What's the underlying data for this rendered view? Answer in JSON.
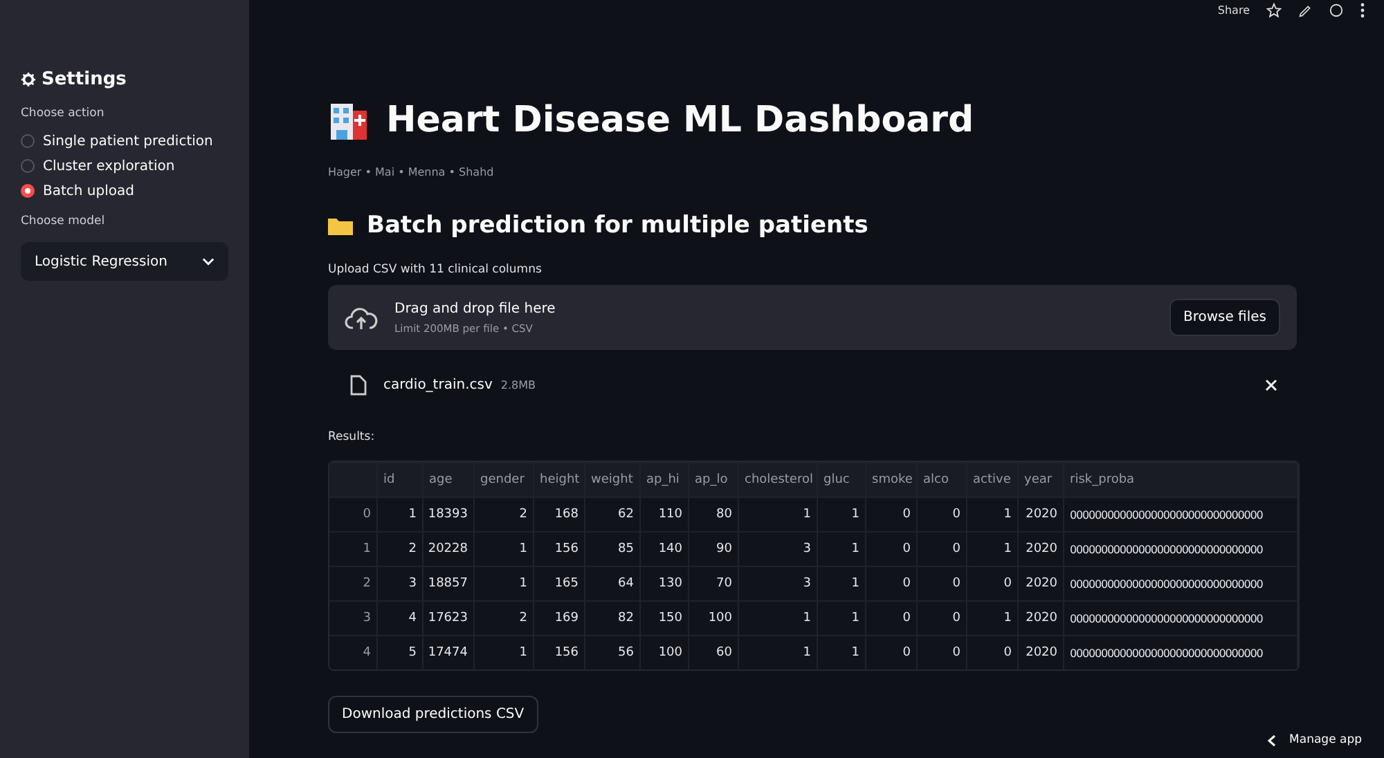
{
  "toolbar": {
    "share": "Share"
  },
  "sidebar": {
    "title": "Settings",
    "action_label": "Choose action",
    "actions": [
      {
        "label": "Single patient prediction",
        "selected": false
      },
      {
        "label": "Cluster exploration",
        "selected": false
      },
      {
        "label": "Batch upload",
        "selected": true
      }
    ],
    "model_label": "Choose model",
    "model": "Logistic Regression"
  },
  "title": "Heart Disease ML Dashboard",
  "authors": "Hager • Mai • Menna • Shahd",
  "section": "Batch prediction for multiple patients",
  "uploader": {
    "label": "Upload CSV with 11 clinical columns",
    "drop_text": "Drag and drop file here",
    "limit": "Limit 200MB per file • CSV",
    "button": "Browse files"
  },
  "file": {
    "name": "cardio_train.csv",
    "size": "2.8MB"
  },
  "results_label": "Results:",
  "table": {
    "columns": [
      "id",
      "age",
      "gender",
      "height",
      "weight",
      "ap_hi",
      "ap_lo",
      "cholesterol",
      "gluc",
      "smoke",
      "alco",
      "active",
      "year",
      "risk_proba"
    ],
    "rows": [
      {
        "index": "0",
        "cells": [
          "1",
          "18393",
          "2",
          "168",
          "62",
          "110",
          "80",
          "1",
          "1",
          "0",
          "0",
          "1",
          "2020",
          "0000000000000000000000000000000"
        ]
      },
      {
        "index": "1",
        "cells": [
          "2",
          "20228",
          "1",
          "156",
          "85",
          "140",
          "90",
          "3",
          "1",
          "0",
          "0",
          "1",
          "2020",
          "0000000000000000000000000000000"
        ]
      },
      {
        "index": "2",
        "cells": [
          "3",
          "18857",
          "1",
          "165",
          "64",
          "130",
          "70",
          "3",
          "1",
          "0",
          "0",
          "0",
          "2020",
          "0000000000000000000000000000000"
        ]
      },
      {
        "index": "3",
        "cells": [
          "4",
          "17623",
          "2",
          "169",
          "82",
          "150",
          "100",
          "1",
          "1",
          "0",
          "0",
          "1",
          "2020",
          "0000000000000000000000000000000"
        ]
      },
      {
        "index": "4",
        "cells": [
          "5",
          "17474",
          "1",
          "156",
          "56",
          "100",
          "60",
          "1",
          "1",
          "0",
          "0",
          "0",
          "2020",
          "0000000000000000000000000000000"
        ]
      }
    ]
  },
  "download_button": "Download predictions CSV",
  "manage_app": "Manage app"
}
